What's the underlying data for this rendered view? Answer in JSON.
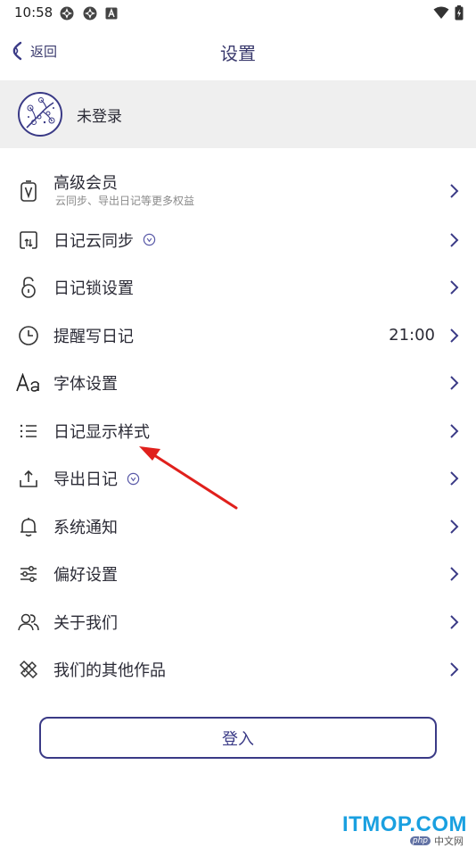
{
  "status_bar": {
    "time": "10:58",
    "left_icons": [
      "sync-app-icon",
      "sync-app-icon",
      "font-app-icon"
    ],
    "right_icons": [
      "wifi-icon",
      "battery-icon"
    ]
  },
  "nav": {
    "back_label": "返回",
    "title": "设置"
  },
  "account": {
    "name": "未登录"
  },
  "settings": {
    "items": [
      {
        "label": "高级会员",
        "subtitle": "云同步、导出日记等更多权益",
        "icon": "vip-card-icon"
      },
      {
        "label": "日记云同步",
        "icon": "cloud-sync-icon",
        "badge": "vip-coin-icon"
      },
      {
        "label": "日记锁设置",
        "icon": "lock-icon"
      },
      {
        "label": "提醒写日记",
        "icon": "clock-icon",
        "value": "21:00"
      },
      {
        "label": "字体设置",
        "icon": "font-aa-icon"
      },
      {
        "label": "日记显示样式",
        "icon": "list-style-icon"
      },
      {
        "label": "导出日记",
        "icon": "export-icon",
        "badge": "vip-coin-icon"
      },
      {
        "label": "系统通知",
        "icon": "bell-icon"
      },
      {
        "label": "偏好设置",
        "icon": "sliders-icon"
      },
      {
        "label": "关于我们",
        "icon": "people-icon"
      },
      {
        "label": "我们的其他作品",
        "icon": "works-icon"
      }
    ]
  },
  "login": {
    "label": "登入"
  },
  "watermark": {
    "brand": "ITMOP.COM",
    "sub_badge": "php",
    "sub_text": "中文网"
  },
  "colors": {
    "accent": "#3a3a86",
    "annotation_arrow": "#e0201c",
    "account_bg": "#efefef"
  }
}
